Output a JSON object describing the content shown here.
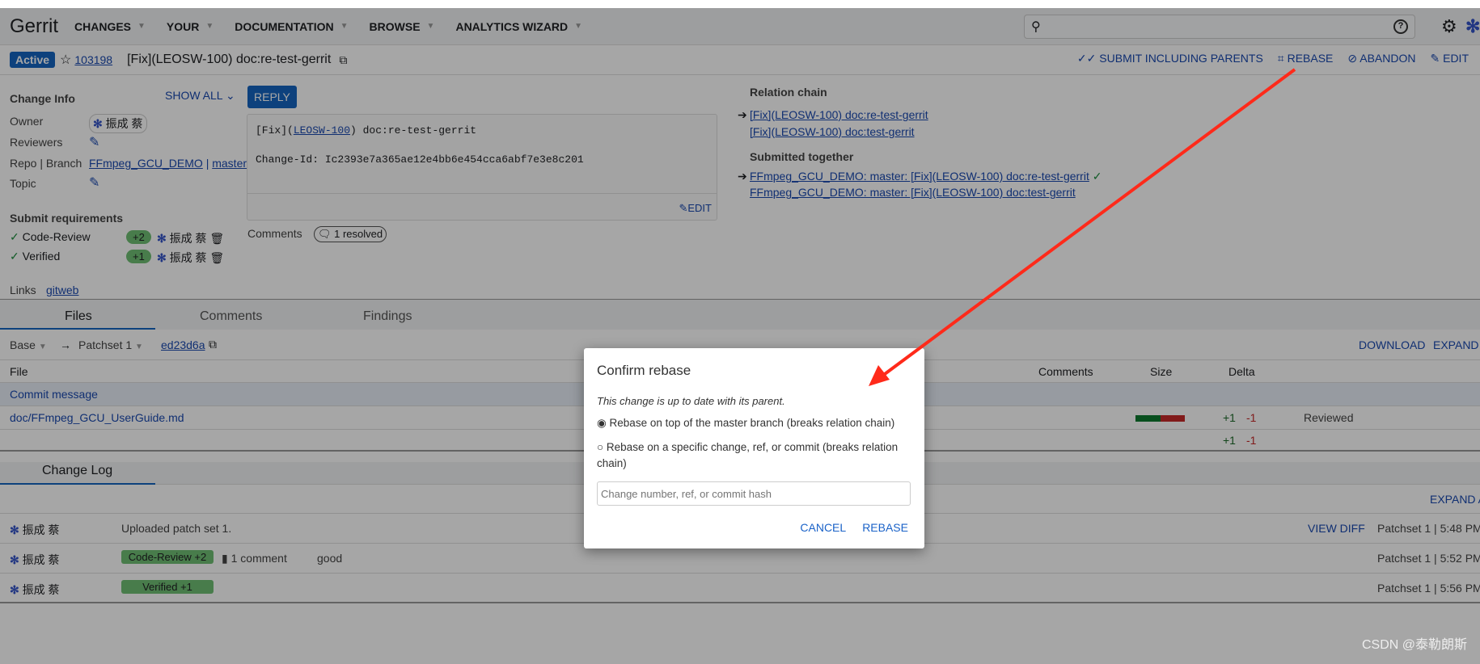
{
  "nav": {
    "logo": "Gerrit",
    "items": [
      "CHANGES",
      "YOUR",
      "DOCUMENTATION",
      "BROWSE",
      "ANALYTICS WIZARD"
    ]
  },
  "header": {
    "status": "Active",
    "change_number": "103198",
    "subject": "[Fix](LEOSW-100) doc:re-test-gerrit",
    "actions": [
      "SUBMIT INCLUDING PARENTS",
      "REBASE",
      "ABANDON",
      "EDIT"
    ]
  },
  "info": {
    "title": "Change Info",
    "show_all": "SHOW ALL",
    "owner_label": "Owner",
    "owner": "振成 蔡",
    "reviewers_label": "Reviewers",
    "repo_label": "Repo | Branch",
    "repo": "FFmpeg_GCU_DEMO",
    "sep": "|",
    "branch": "master",
    "topic_label": "Topic",
    "submit_title": "Submit requirements",
    "requirements": [
      {
        "name": "Code-Review",
        "vote": "+2",
        "user": "振成 蔡"
      },
      {
        "name": "Verified",
        "vote": "+1",
        "user": "振成 蔡"
      }
    ],
    "links_label": "Links",
    "links": "gitweb"
  },
  "reply": "REPLY",
  "commit": {
    "prefix": "[Fix](",
    "ticket": "LEOSW-100",
    "suffix": ") doc:re-test-gerrit",
    "change_id": "Change-Id: Ic2393e7a365ae12e4bb6e454cca6abf7e3e8c201",
    "edit": "EDIT"
  },
  "comments": {
    "label": "Comments",
    "resolved": "1 resolved"
  },
  "relation": {
    "title": "Relation chain",
    "items": [
      "[Fix](LEOSW-100) doc:re-test-gerrit",
      "[Fix](LEOSW-100) doc:test-gerrit"
    ],
    "submitted_title": "Submitted together",
    "submitted": [
      "FFmpeg_GCU_DEMO: master: [Fix](LEOSW-100) doc:re-test-gerrit",
      "FFmpeg_GCU_DEMO: master: [Fix](LEOSW-100) doc:test-gerrit"
    ],
    "check": "✓"
  },
  "tabs": [
    "Files",
    "Comments",
    "Findings"
  ],
  "files": {
    "base": "Base",
    "arrow": "→",
    "patchset": "Patchset 1",
    "commit": "ed23d6a",
    "download": "DOWNLOAD",
    "expand": "EXPAND ALL",
    "headers": {
      "file": "File",
      "comments": "Comments",
      "size": "Size",
      "delta": "Delta"
    },
    "rows": [
      {
        "name": "Commit message"
      },
      {
        "name": "doc/FFmpeg_GCU_UserGuide.md",
        "plus": "+1",
        "minus": "-1",
        "status": "Reviewed"
      }
    ],
    "total": {
      "plus": "+1",
      "minus": "-1"
    }
  },
  "changelog": {
    "tab": "Change Log",
    "expand": "EXPAND ALL",
    "rows": [
      {
        "user": "振成 蔡",
        "msg": "Uploaded patch set 1.",
        "view_diff": "VIEW DIFF",
        "meta": "Patchset 1 | 5:48 PM"
      },
      {
        "user": "振成 蔡",
        "tag": "Code-Review +2",
        "comments": "1 comment",
        "msg": "good",
        "meta": "Patchset 1 | 5:52 PM"
      },
      {
        "user": "振成 蔡",
        "tag": "Verified +1",
        "meta": "Patchset 1 | 5:56 PM"
      }
    ]
  },
  "dialog": {
    "title": "Confirm rebase",
    "info": "This change is up to date with its parent.",
    "option1": "Rebase on top of the master branch (breaks relation chain)",
    "option2": "Rebase on a specific change, ref, or commit (breaks relation chain)",
    "placeholder": "Change number, ref, or commit hash",
    "cancel": "CANCEL",
    "rebase": "REBASE",
    "selected": "option1"
  },
  "watermark": "CSDN @泰勒朗斯",
  "colors": {
    "accent": "#1565c0",
    "vote": "#6fbf73",
    "annotation_arrow": "#ff2a1a"
  }
}
